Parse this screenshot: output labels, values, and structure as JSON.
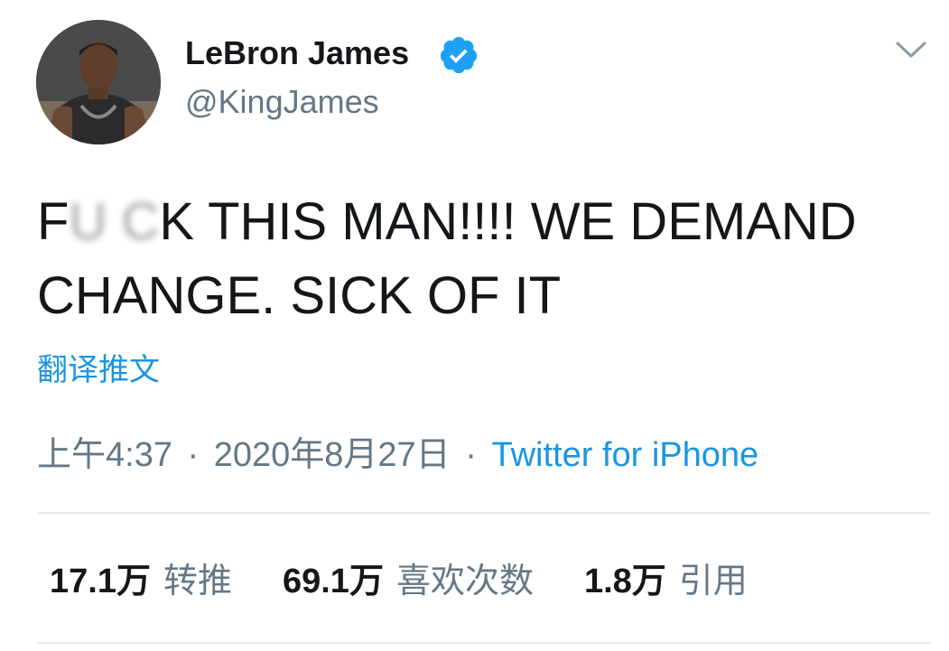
{
  "user": {
    "display_name": "LeBron James",
    "handle": "@KingJames",
    "verified": true
  },
  "tweet": {
    "text_censored_prefix": "F",
    "text_censored_blur": "U C",
    "text_rest": "K THIS MAN!!!! WE DEMAND CHANGE. SICK OF IT",
    "translate_label": "翻译推文",
    "time": "上午4:37",
    "date": "2020年8月27日",
    "separator": "·",
    "source": "Twitter for iPhone"
  },
  "stats": [
    {
      "count": "17.1万",
      "label": "转推"
    },
    {
      "count": "69.1万",
      "label": "喜欢次数"
    },
    {
      "count": "1.8万",
      "label": "引用"
    }
  ],
  "icons": {
    "verified": "verified-badge-icon",
    "menu": "chevron-down-icon"
  },
  "colors": {
    "link": "#1b95e0",
    "secondary_text": "#657786",
    "primary_text": "#14171a",
    "divider": "#e6ecf0"
  }
}
